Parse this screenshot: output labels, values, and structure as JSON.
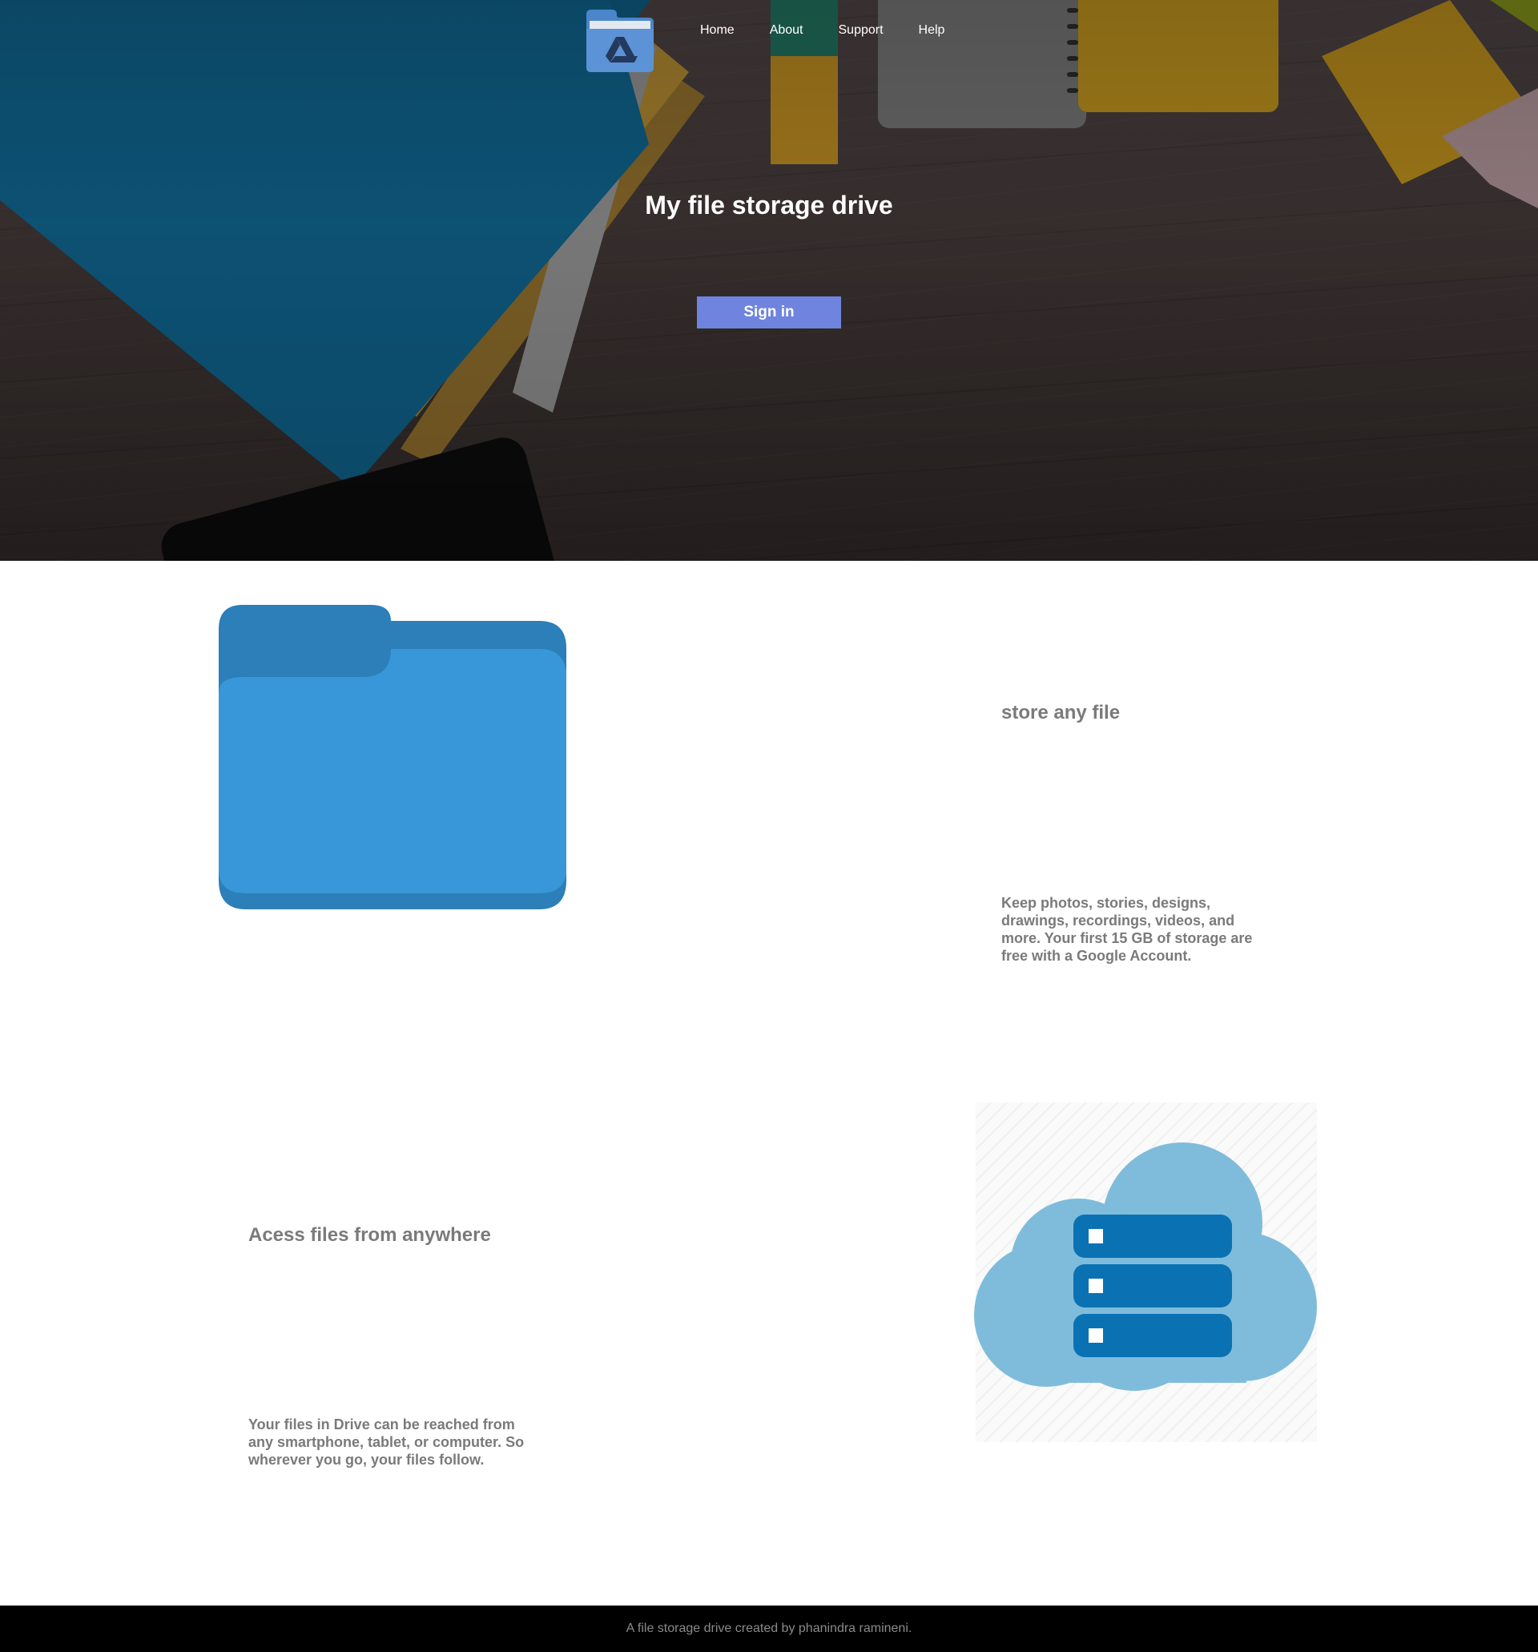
{
  "nav": {
    "logo_icon": "drive-folder-icon",
    "items": [
      {
        "label": "Home"
      },
      {
        "label": "About"
      },
      {
        "label": "Support"
      },
      {
        "label": "Help"
      }
    ]
  },
  "hero": {
    "title": "My file storage drive",
    "signin_label": "Sign in"
  },
  "features": [
    {
      "icon": "folder-icon",
      "heading": "store any file",
      "text": "Keep photos, stories, designs, drawings, recordings, videos, and more. Your first 15 GB of storage are free with a Google Account."
    },
    {
      "icon": "cloud-server-icon",
      "heading": "Acess files from anywhere",
      "text": "Your files in Drive can be reached from any smartphone, tablet, or computer. So wherever you go, your files follow."
    }
  ],
  "footer": {
    "text": "A file storage drive created by phanindra ramineni."
  },
  "colors": {
    "signin_button": "#6e84de",
    "folder_blue": "#3897d8",
    "folder_tab": "#2c7fb8",
    "cloud": "#7fbcdc",
    "server": "#0a72b3",
    "text_grey": "#7a7a7a",
    "footer_bg": "#000000"
  }
}
